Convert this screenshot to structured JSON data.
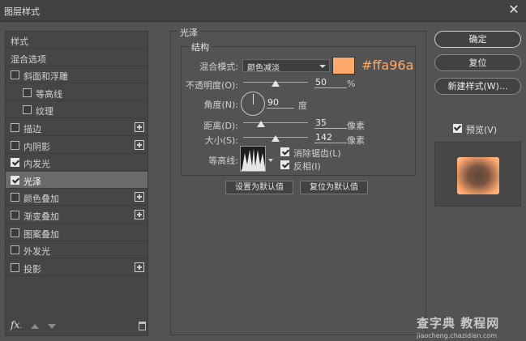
{
  "window": {
    "title": "图层样式",
    "close_glyph": "✕"
  },
  "left_panel": {
    "items": [
      {
        "label": "样式",
        "checkbox": false,
        "checked": false,
        "plus": false,
        "indent": false
      },
      {
        "label": "混合选项",
        "checkbox": false,
        "checked": false,
        "plus": false,
        "indent": false
      },
      {
        "label": "斜面和浮雕",
        "checkbox": true,
        "checked": false,
        "plus": false,
        "indent": false
      },
      {
        "label": "等高线",
        "checkbox": true,
        "checked": false,
        "plus": false,
        "indent": true
      },
      {
        "label": "纹理",
        "checkbox": true,
        "checked": false,
        "plus": false,
        "indent": true
      },
      {
        "label": "描边",
        "checkbox": true,
        "checked": false,
        "plus": true,
        "indent": false
      },
      {
        "label": "内阴影",
        "checkbox": true,
        "checked": false,
        "plus": true,
        "indent": false
      },
      {
        "label": "内发光",
        "checkbox": true,
        "checked": true,
        "plus": false,
        "indent": false
      },
      {
        "label": "光泽",
        "checkbox": true,
        "checked": true,
        "plus": false,
        "indent": false,
        "selected": true
      },
      {
        "label": "颜色叠加",
        "checkbox": true,
        "checked": false,
        "plus": true,
        "indent": false
      },
      {
        "label": "渐变叠加",
        "checkbox": true,
        "checked": false,
        "plus": true,
        "indent": false
      },
      {
        "label": "图案叠加",
        "checkbox": true,
        "checked": false,
        "plus": false,
        "indent": false
      },
      {
        "label": "外发光",
        "checkbox": true,
        "checked": false,
        "plus": false,
        "indent": false
      },
      {
        "label": "投影",
        "checkbox": true,
        "checked": false,
        "plus": true,
        "indent": false
      }
    ],
    "toolbar": {
      "fx_label": "fx",
      "fx_suffix": "."
    }
  },
  "satin": {
    "group_title": "光泽",
    "structure_title": "结构",
    "blend_mode_label": "混合模式:",
    "blend_mode_value": "颜色减淡",
    "color": "#ffa96a",
    "color_hex_label": "#ffa96a",
    "opacity_label": "不透明度(O):",
    "opacity_value": "50",
    "opacity_fraction": 0.5,
    "opacity_unit": "%",
    "angle_label": "角度(N):",
    "angle_value": "90",
    "angle_unit": "度",
    "distance_label": "距离(D):",
    "distance_value": "35",
    "distance_fraction": 0.28,
    "distance_unit": "像素",
    "size_label": "大小(S):",
    "size_value": "142",
    "size_fraction": 0.5,
    "size_unit": "像素",
    "contour_label": "等高线:",
    "antialias_label": "消除锯齿(L)",
    "antialias_checked": true,
    "invert_label": "反相(I)",
    "invert_checked": true,
    "set_default_label": "设置为默认值",
    "reset_default_label": "复位为默认值"
  },
  "right_panel": {
    "ok_label": "确定",
    "reset_label": "复位",
    "new_style_label": "新建样式(W)...",
    "preview_label": "预览(V)",
    "preview_checked": true
  },
  "watermark": {
    "line1": "查字典 教程网",
    "line2": "jiaocheng.chazidian.com"
  },
  "colors": {
    "accent": "#ffa96a",
    "panel": "#535353",
    "list_bg": "#464646",
    "selected": "#6a6a6a"
  }
}
